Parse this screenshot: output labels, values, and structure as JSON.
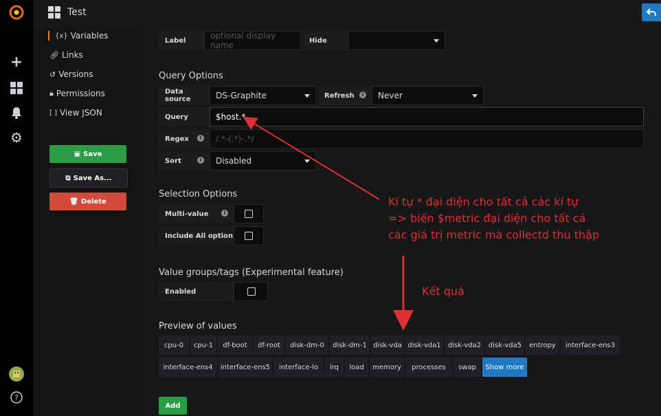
{
  "topbar": {
    "title": "Test"
  },
  "sidemenu": {
    "items": [
      {
        "label": "Variables",
        "icon": "variables-icon"
      },
      {
        "label": "Links",
        "icon": "link-icon"
      },
      {
        "label": "Versions",
        "icon": "history-icon"
      },
      {
        "label": "Permissions",
        "icon": "lock-icon"
      },
      {
        "label": "View JSON",
        "icon": "code-icon"
      }
    ],
    "save_label": "Save",
    "save_as_label": "Save As...",
    "delete_label": "Delete"
  },
  "general": {
    "label_label": "Label",
    "label_placeholder": "optional display name",
    "hide_label": "Hide",
    "hide_value": ""
  },
  "query_options": {
    "title": "Query Options",
    "datasource_label": "Data source",
    "datasource_value": "DS-Graphite",
    "refresh_label": "Refresh",
    "refresh_value": "Never",
    "query_label": "Query",
    "query_value": "$host.*",
    "regex_label": "Regex",
    "regex_placeholder": "/.*-(.*)-.*/",
    "sort_label": "Sort",
    "sort_value": "Disabled"
  },
  "selection_options": {
    "title": "Selection Options",
    "multi_value_label": "Multi-value",
    "include_all_label": "Include All option"
  },
  "value_groups": {
    "title": "Value groups/tags (Experimental feature)",
    "enabled_label": "Enabled"
  },
  "preview": {
    "title": "Preview of values",
    "row1": [
      "cpu-0",
      "cpu-1",
      "df-boot",
      "df-root",
      "disk-dm-0",
      "disk-dm-1",
      "disk-vda",
      "disk-vda1",
      "disk-vda2",
      "disk-vda5",
      "entropy",
      "interface-ens3"
    ],
    "row2": [
      "interface-ens4",
      "interface-ens5",
      "interface-lo",
      "irq",
      "load",
      "memory",
      "processes",
      "swap"
    ],
    "show_more_label": "Show more"
  },
  "add_label": "Add",
  "annotation": {
    "line1": "Kí tự * đại diện cho tất cả các kí tự",
    "line2": "=> biến $metric đại diện cho tất cả",
    "line3": "các giá trị metric mà collectd thu thập",
    "result": "Kết quả"
  },
  "colors": {
    "save": "#299c46",
    "delete": "#d44a3a",
    "add": "#299c46",
    "show_more": "#1f78c1",
    "annotation": "#e02f2f"
  }
}
